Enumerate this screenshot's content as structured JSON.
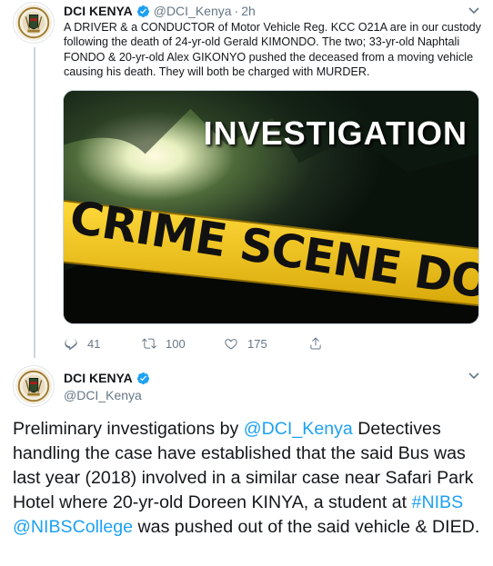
{
  "tweet1": {
    "display_name": "DCI KENYA",
    "handle": "@DCI_Kenya",
    "separator": "·",
    "time": "2h",
    "text": "A DRIVER & a CONDUCTOR of Motor Vehicle Reg. KCC O21A are in our custody following the death of 24-yr-old Gerald KIMONDO. The two; 33-yr-old Naphtali FONDO & 20-yr-old Alex GIKONYO pushed the deceased from a moving vehicle causing his death. They will both be charged with MURDER.",
    "media": {
      "headline": "INVESTIGATION",
      "tape_text": "CRIME SCENE DO NOT CROSS CRI"
    },
    "actions": {
      "replies": "41",
      "retweets": "100",
      "likes": "175"
    }
  },
  "tweet2": {
    "display_name": "DCI KENYA",
    "handle": "@DCI_Kenya",
    "text_parts": {
      "p1": "Preliminary investigations by ",
      "mention1": "@DCI_Kenya",
      "p2": " Detectives handling the case have established that the said Bus was last year (2018) involved in a similar case near Safari Park Hotel where 20-yr-old Doreen KINYA, a student at ",
      "hashtag1": "#NIBS",
      "p3": " ",
      "mention2": "@NIBSCollege",
      "p4": " was pushed out of the said vehicle & DIED."
    }
  },
  "colors": {
    "link": "#1da1f2",
    "muted": "#657786",
    "text": "#14171a",
    "tape": "#f2c418"
  },
  "icons": [
    "verified-badge-icon",
    "chevron-down-icon",
    "reply-icon",
    "retweet-icon",
    "like-icon",
    "share-icon",
    "dci-crest-icon"
  ]
}
